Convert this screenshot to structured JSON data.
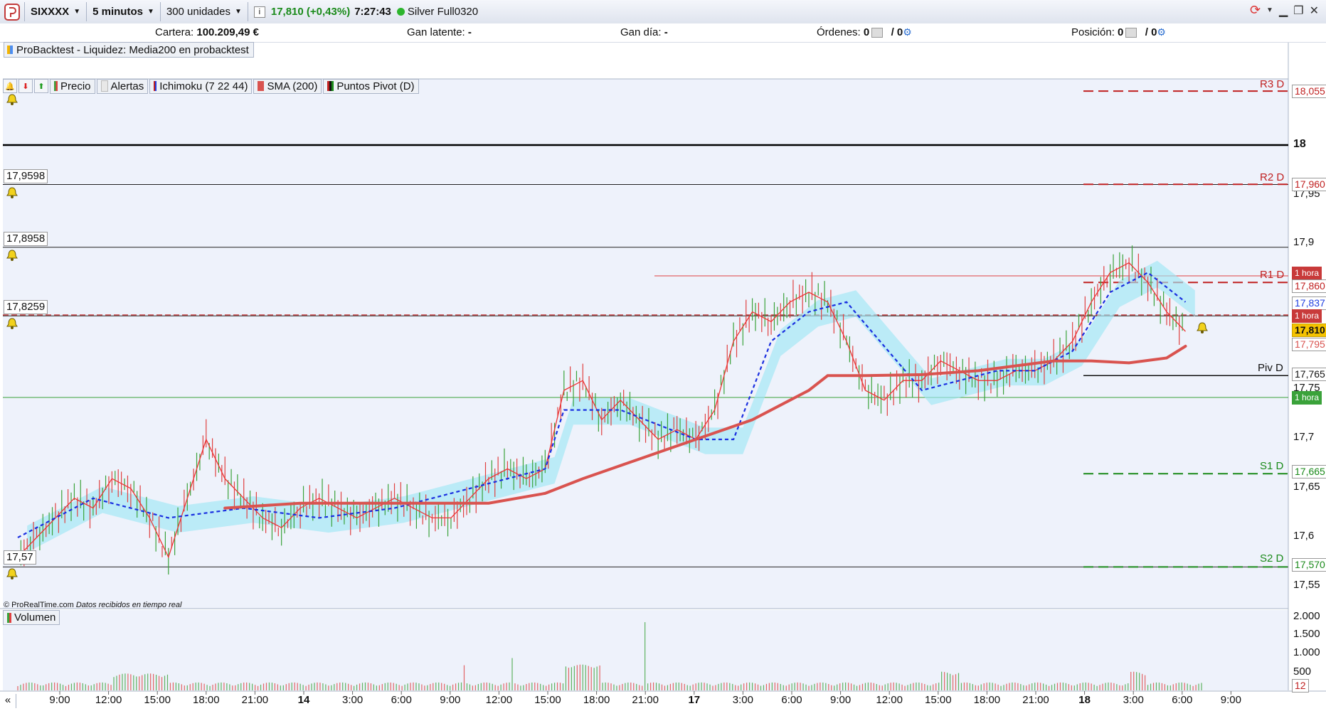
{
  "toolbar": {
    "symbol": "SIXXXX",
    "timeframe": "5 minutos",
    "units": "300 unidades",
    "price": "17,810 (+0,43%)",
    "time": "7:27:43",
    "status": "Silver Full0320",
    "colors": {
      "price_up": "#1a8a1a",
      "status_dot": "#2db52d"
    }
  },
  "account": {
    "cartera_label": "Cartera:",
    "cartera_value": "100.209,49 €",
    "gan_latente_label": "Gan latente:",
    "gan_latente_value": "-",
    "gan_dia_label": "Gan día:",
    "gan_dia_value": "-",
    "ordenes_label": "Órdenes:",
    "ordenes_a": "0",
    "ordenes_b": "/ 0",
    "posicion_label": "Posición:",
    "posicion_a": "0",
    "posicion_b": "/ 0"
  },
  "backtest_label": "ProBacktest - Liquidez: Media200 en probacktest",
  "legend": {
    "precio": "Precio",
    "alertas": "Alertas",
    "ichimoku": "Ichimoku (7 22 44)",
    "sma": "SMA (200)",
    "pivot": "Puntos Pivot (D)"
  },
  "alert_levels": [
    "17,9598",
    "17,8958",
    "17,8259",
    "17,57"
  ],
  "pivot_labels": {
    "r3": "R3 D",
    "r2": "R2 D",
    "r1": "R1 D",
    "piv": "Piv D",
    "s1": "S1 D",
    "s2": "S2 D"
  },
  "price_axis": {
    "ticks": [
      "18",
      "17,95",
      "17,9",
      "17,75",
      "17,7",
      "17,65",
      "17,6",
      "17,55"
    ],
    "tags": {
      "r3": "18,055",
      "r2": "17,960",
      "hora1": "1 hora",
      "r1": "17,860",
      "ichi": "17,837",
      "hora2": "1 hora",
      "last": "17,810",
      "sma": "17,795",
      "piv": "17,765",
      "hora3": "1 hora",
      "s1": "17,665",
      "s2": "17,570"
    }
  },
  "credit": {
    "brand": "© ProRealTime.com",
    "note": "Datos recibidos en tiempo real"
  },
  "volume": {
    "label": "Volumen",
    "ticks": [
      "2.000",
      "1.500",
      "1.000",
      "500"
    ],
    "current": "12"
  },
  "time_axis": {
    "labels": [
      "9:00",
      "12:00",
      "15:00",
      "18:00",
      "21:00",
      "14",
      "3:00",
      "6:00",
      "9:00",
      "12:00",
      "15:00",
      "18:00",
      "21:00",
      "17",
      "3:00",
      "6:00",
      "9:00",
      "12:00",
      "15:00",
      "18:00",
      "21:00",
      "18",
      "3:00",
      "6:00",
      "9:00"
    ],
    "bold": [
      "14",
      "17",
      "18"
    ]
  },
  "chart_data": {
    "type": "line",
    "symbol": "SIXXXX",
    "timeframe": "5 minutos",
    "pivots": {
      "R3": 18.055,
      "R2": 17.96,
      "R1": 17.86,
      "Piv": 17.765,
      "S1": 17.665,
      "S2": 17.57
    },
    "alerts": [
      17.9598,
      17.8958,
      17.8259,
      17.57
    ],
    "price": {
      "t": [
        0,
        2,
        4,
        6,
        8,
        10,
        12,
        14,
        16,
        18,
        20,
        22,
        24,
        26,
        28,
        30,
        32,
        34,
        36,
        38,
        40,
        42,
        44,
        46,
        48,
        50,
        52,
        54,
        56,
        58,
        60,
        62,
        64,
        66,
        68,
        70,
        72,
        74,
        76,
        78,
        80,
        82,
        84,
        86,
        88,
        90,
        92,
        94,
        96,
        98,
        100,
        102,
        104,
        106,
        108,
        110,
        112,
        114,
        116,
        118,
        120,
        122,
        124
      ],
      "v": [
        17.58,
        17.6,
        17.62,
        17.64,
        17.63,
        17.66,
        17.65,
        17.62,
        17.58,
        17.64,
        17.7,
        17.66,
        17.64,
        17.62,
        17.61,
        17.63,
        17.64,
        17.63,
        17.62,
        17.63,
        17.64,
        17.63,
        17.62,
        17.62,
        17.64,
        17.66,
        17.67,
        17.66,
        17.67,
        17.75,
        17.76,
        17.72,
        17.74,
        17.72,
        17.7,
        17.71,
        17.7,
        17.73,
        17.8,
        17.83,
        17.82,
        17.84,
        17.85,
        17.84,
        17.8,
        17.75,
        17.74,
        17.76,
        17.76,
        17.78,
        17.77,
        17.76,
        17.76,
        17.77,
        17.77,
        17.78,
        17.8,
        17.84,
        17.87,
        17.88,
        17.86,
        17.83,
        17.81
      ]
    },
    "ichimoku_kijun": {
      "t": [
        0,
        8,
        16,
        24,
        32,
        40,
        48,
        56,
        58,
        64,
        72,
        76,
        80,
        84,
        88,
        96,
        100,
        104,
        108,
        112,
        116,
        120,
        124
      ],
      "v": [
        17.6,
        17.64,
        17.62,
        17.63,
        17.62,
        17.63,
        17.65,
        17.67,
        17.73,
        17.73,
        17.7,
        17.7,
        17.8,
        17.83,
        17.84,
        17.75,
        17.76,
        17.77,
        17.77,
        17.79,
        17.85,
        17.87,
        17.84
      ]
    },
    "sma200": {
      "t": [
        22,
        30,
        40,
        50,
        56,
        60,
        66,
        72,
        78,
        84,
        86,
        90,
        96,
        102,
        106,
        110,
        114,
        118,
        122,
        124
      ],
      "v": [
        17.63,
        17.635,
        17.635,
        17.635,
        17.645,
        17.66,
        17.68,
        17.7,
        17.72,
        17.75,
        17.765,
        17.765,
        17.766,
        17.77,
        17.775,
        17.78,
        17.78,
        17.778,
        17.783,
        17.795
      ]
    },
    "time_labels": [
      "9:00",
      "12:00",
      "15:00",
      "18:00",
      "21:00",
      "14",
      "3:00",
      "6:00",
      "9:00",
      "12:00",
      "15:00",
      "18:00",
      "21:00",
      "17",
      "3:00",
      "6:00",
      "9:00",
      "12:00",
      "15:00",
      "18:00",
      "21:00",
      "18",
      "3:00",
      "6:00",
      "9:00"
    ],
    "volume_range": [
      0,
      2000
    ]
  }
}
